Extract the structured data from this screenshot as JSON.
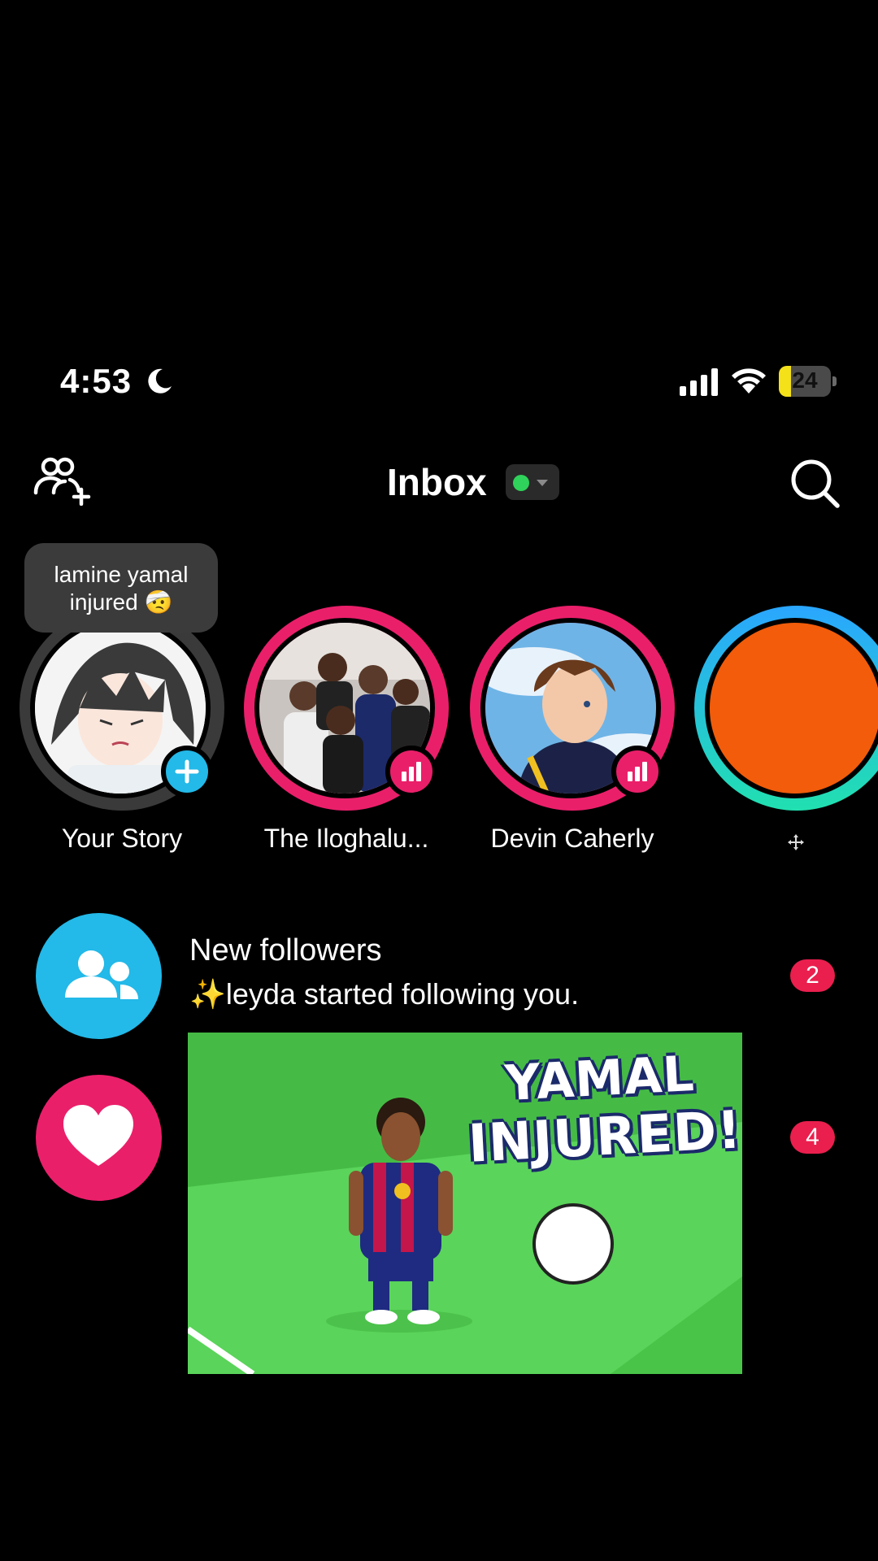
{
  "status_bar": {
    "time": "4:53",
    "battery_percent": "24",
    "battery_level": 0.24
  },
  "header": {
    "title": "Inbox",
    "online_status_color": "#2fd25a"
  },
  "tooltip": {
    "line1": "lamine yamal",
    "line2": "injured 🤕"
  },
  "stories": [
    {
      "name": "Your Story",
      "ring_color": "#3a3a3a",
      "badge": "add"
    },
    {
      "name": "The Iloghalu...",
      "ring_color": "#ea1f6a",
      "badge": "live"
    },
    {
      "name": "Devin Caherly",
      "ring_color": "#ea1f6a",
      "badge": "live"
    },
    {
      "name": "",
      "ring_color": "#22c7d6",
      "badge": "none",
      "avatar_color": "#f25c0a"
    }
  ],
  "rows": [
    {
      "title": "New followers",
      "subtitle": "✨leyda started following you.",
      "count": "2",
      "icon": "followers-icon",
      "icon_color": "#23b9e8"
    },
    {
      "title": "",
      "subtitle": "",
      "count": "4",
      "icon": "heart-icon",
      "icon_color": "#ea1f6a"
    }
  ],
  "video": {
    "headline_line1": "YAMAL",
    "headline_line2": "INJURED!"
  },
  "colors": {
    "accent_pink": "#ea1f6a",
    "accent_blue": "#23b9e8",
    "badge_red": "#ea1f4e"
  }
}
